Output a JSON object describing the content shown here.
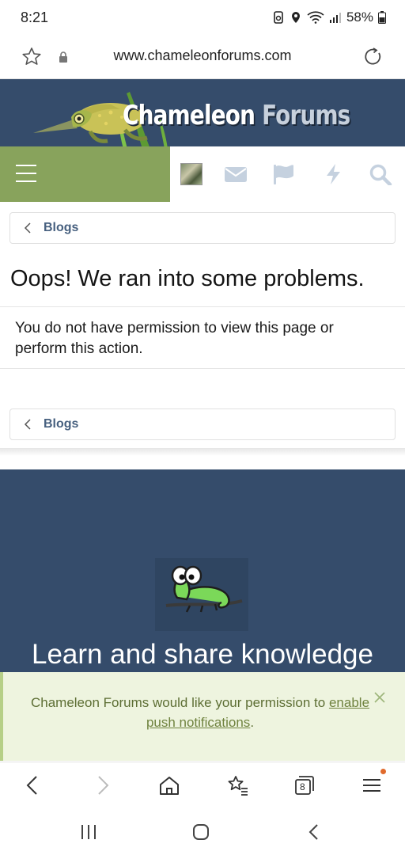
{
  "status_bar": {
    "time": "8:21",
    "battery": "58%"
  },
  "browser": {
    "url": "www.chameleonforums.com",
    "tab_count": "8"
  },
  "site": {
    "logo_word_1": "Chameleon",
    "logo_word_2": "Forums",
    "brand_color": "#354c6b",
    "accent_color": "#88a35c"
  },
  "nav_icons": [
    "menu-icon",
    "avatar",
    "mail-icon",
    "flag-icon",
    "bolt-icon",
    "search-icon"
  ],
  "breadcrumb_top": {
    "label": "Blogs"
  },
  "error": {
    "title": "Oops! We ran into some problems.",
    "message": "You do not have permission to view this page or perform this action."
  },
  "breadcrumb_bottom": {
    "label": "Blogs"
  },
  "footer": {
    "tagline": "Learn and share knowledge"
  },
  "notice": {
    "text_before": "Chameleon Forums would like your permission to ",
    "link_text": "enable push notifications",
    "text_after": "."
  }
}
